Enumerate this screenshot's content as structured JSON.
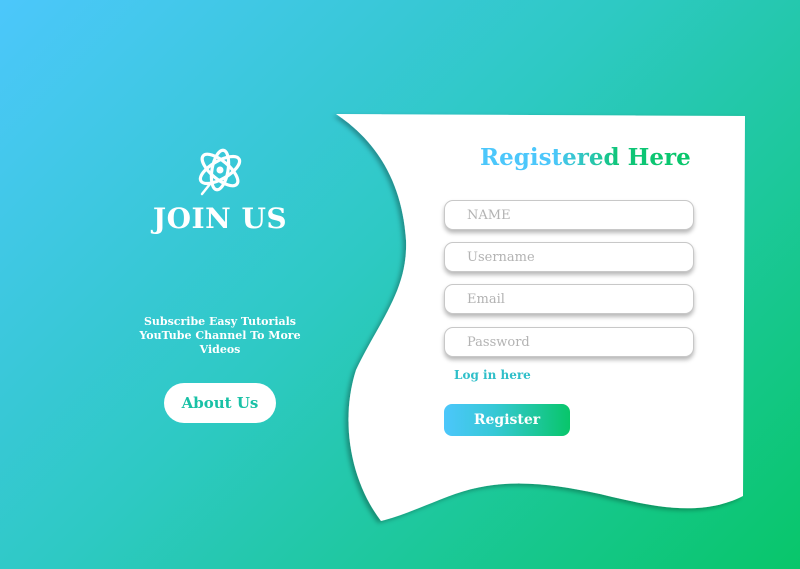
{
  "left_panel": {
    "logo_icon": "swirl-logo-icon",
    "title": "JOIN US",
    "subscribe_text": "Subscribe Easy Tutorials YouTube Channel To More Videos",
    "about_button": "About Us"
  },
  "form": {
    "title": "Registered Here",
    "fields": {
      "name_placeholder": "NAME",
      "username_placeholder": "Username",
      "email_placeholder": "Email",
      "password_placeholder": "Password"
    },
    "login_link": "Log in here",
    "register_button": "Register"
  },
  "colors": {
    "gradient_start": "#4cc7fb",
    "gradient_end": "#08c66a",
    "card": "#ffffff"
  }
}
